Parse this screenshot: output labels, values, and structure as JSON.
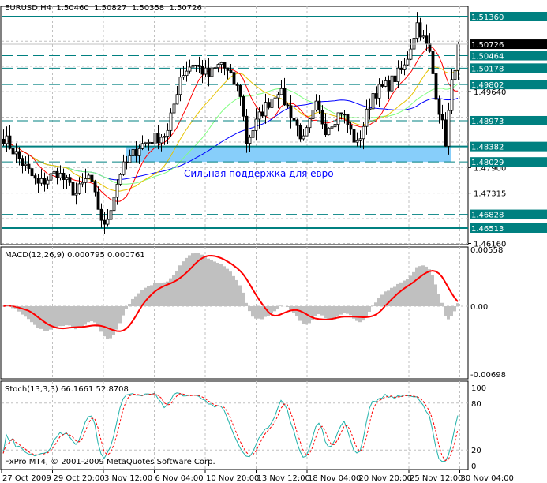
{
  "header": {
    "symbol": "EURUSD,H4",
    "open": "1.50460",
    "high": "1.50827",
    "low": "1.50358",
    "close": "1.50726"
  },
  "annotation": "Сильная поддержка для евро",
  "copyright": "FxPro MT4, © 2001-2009 MetaQuotes Software Corp.",
  "macd_label": "MACD(12,26,9) 0.000795 0.000761",
  "stoch_label": "Stoch(13,3,3) 66.1661 52.8708",
  "colors": {
    "level": "#008080",
    "support_zone": "#87cefa",
    "annotation": "#0000ff",
    "macd_hist": "#c0c0c0",
    "signal": "#ff0000",
    "stoch_main": "#20b2aa"
  },
  "chart_data": {
    "type": "candlestick",
    "price_axis_ticks": [
      "1.46160",
      "1.47315",
      "1.47900",
      "1.49640"
    ],
    "current_price": "1.50726",
    "solid_levels": [
      "1.51360",
      "1.48382",
      "1.46513"
    ],
    "dashed_levels": [
      "1.50464",
      "1.50178",
      "1.49802",
      "1.48973",
      "1.48029",
      "1.46828"
    ],
    "support_zone": [
      1.48029,
      1.48382
    ],
    "support_zone_start_bar": 39,
    "support_zone_end_bar": 142,
    "close_keypoints": [
      [
        0,
        1.486
      ],
      [
        5,
        1.481
      ],
      [
        11,
        1.475
      ],
      [
        17,
        1.478
      ],
      [
        23,
        1.473
      ],
      [
        27,
        1.477
      ],
      [
        32,
        1.465
      ],
      [
        37,
        1.478
      ],
      [
        43,
        1.484
      ],
      [
        52,
        1.487
      ],
      [
        56,
        1.5
      ],
      [
        60,
        1.503
      ],
      [
        65,
        1.5
      ],
      [
        69,
        1.503
      ],
      [
        75,
        1.496
      ],
      [
        77,
        1.485
      ],
      [
        82,
        1.492
      ],
      [
        87,
        1.497
      ],
      [
        92,
        1.49
      ],
      [
        95,
        1.485
      ],
      [
        99,
        1.493
      ],
      [
        102,
        1.488
      ],
      [
        107,
        1.492
      ],
      [
        112,
        1.484
      ],
      [
        117,
        1.496
      ],
      [
        122,
        1.498
      ],
      [
        127,
        1.502
      ],
      [
        131,
        1.512
      ],
      [
        135,
        1.505
      ],
      [
        137,
        1.496
      ],
      [
        140,
        1.485
      ],
      [
        142,
        1.498
      ],
      [
        144,
        1.50726
      ]
    ],
    "time_labels": [
      "27 Oct 2009",
      "29 Oct 20:00",
      "3 Nov 12:00",
      "6 Nov 04:00",
      "10 Nov 20:00",
      "13 Nov 12:00",
      "18 Nov 04:00",
      "20 Nov 20:00",
      "25 Nov 12:00",
      "30 Nov 04:00"
    ],
    "macd": {
      "axis_labels": [
        "0.00558",
        "0.00",
        "-0.00698"
      ],
      "max": 0.00558,
      "min": -0.00698
    },
    "stoch": {
      "axis_labels": [
        "100",
        "80",
        "20",
        "0"
      ]
    }
  }
}
